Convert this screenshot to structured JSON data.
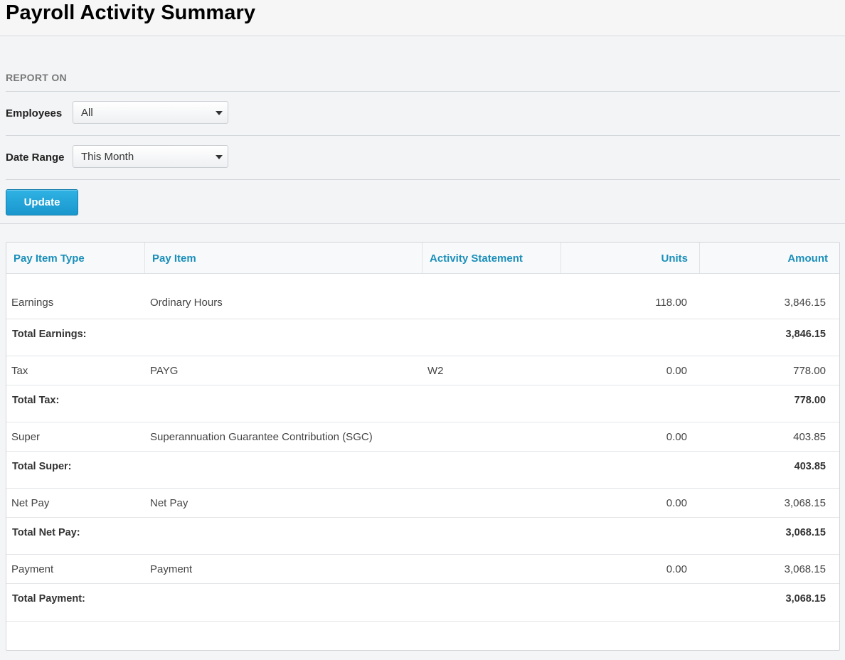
{
  "page": {
    "title": "Payroll Activity Summary"
  },
  "filters": {
    "section_label": "REPORT ON",
    "employees": {
      "label": "Employees",
      "value": "All"
    },
    "date_range": {
      "label": "Date Range",
      "value": "This Month"
    },
    "update_label": "Update"
  },
  "table": {
    "headers": [
      "Pay Item Type",
      "Pay Item",
      "Activity Statement",
      "Units",
      "Amount"
    ],
    "groups": [
      {
        "row": {
          "type": "Earnings",
          "item": "Ordinary Hours",
          "statement": "",
          "units": "118.00",
          "amount": "3,846.15"
        },
        "total": {
          "label": "Total Earnings:",
          "amount": "3,846.15"
        }
      },
      {
        "row": {
          "type": "Tax",
          "item": "PAYG",
          "statement": "W2",
          "units": "0.00",
          "amount": "778.00"
        },
        "total": {
          "label": "Total Tax:",
          "amount": "778.00"
        }
      },
      {
        "row": {
          "type": "Super",
          "item": "Superannuation Guarantee Contribution (SGC)",
          "statement": "",
          "units": "0.00",
          "amount": "403.85"
        },
        "total": {
          "label": "Total Super:",
          "amount": "403.85"
        }
      },
      {
        "row": {
          "type": "Net Pay",
          "item": "Net Pay",
          "statement": "",
          "units": "0.00",
          "amount": "3,068.15"
        },
        "total": {
          "label": "Total Net Pay:",
          "amount": "3,068.15"
        }
      },
      {
        "row": {
          "type": "Payment",
          "item": "Payment",
          "statement": "",
          "units": "0.00",
          "amount": "3,068.15"
        },
        "total": {
          "label": "Total Payment:",
          "amount": "3,068.15"
        }
      }
    ]
  },
  "colors": {
    "accent": "#1a8fba",
    "button": "#1997cd"
  }
}
